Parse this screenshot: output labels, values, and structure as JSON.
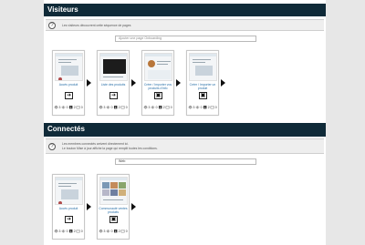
{
  "visitors": {
    "title": "Visiteurs",
    "info_lines": [
      "Les visiteurs découvrent cette séquence de pages"
    ],
    "search": {
      "placeholder": "Ajouter une page Onboarding"
    },
    "cards": [
      {
        "label": "Accès produit",
        "thumb": "landing",
        "action_glyph": "➔",
        "stats": "👁 3 ⚙ 0 ⬇ 2 ✉ 0"
      },
      {
        "label": "Liste des produits",
        "thumb": "dark",
        "action_glyph": "➔",
        "stats": "👁 3 ⚙ 0 ⬇ 2 ✉ 0"
      },
      {
        "label": "Créer / Importer vos produits d'info",
        "thumb": "form",
        "action_glyph": "▣",
        "stats": "👁 3 ⚙ 0 ⬇ 2 ✉ 0"
      },
      {
        "label": "Créer / Importer un produit",
        "thumb": "landing",
        "action_glyph": "▣",
        "stats": "👁 3 ⚙ 0 ⬇ 2 ✉ 0"
      }
    ]
  },
  "connected": {
    "title": "Connectés",
    "info_lines": [
      "Les membres connectés arrivent directement ici.",
      "Le bouton Mise à jour affiche la page qui remplit toutes les conditions."
    ],
    "search": {
      "value": "Web"
    },
    "cards": [
      {
        "label": "Accès produit",
        "thumb": "landing",
        "action_glyph": "➔",
        "stats": "👁 3 ⚙ 0 ⬇ 2 ✉ 0"
      },
      {
        "label": "Communauté ventes produits",
        "thumb": "gallery",
        "action_glyph": "▣",
        "stats": "👁 3 ⚙ 0 ⬇ 2 ✉ 0"
      }
    ]
  }
}
